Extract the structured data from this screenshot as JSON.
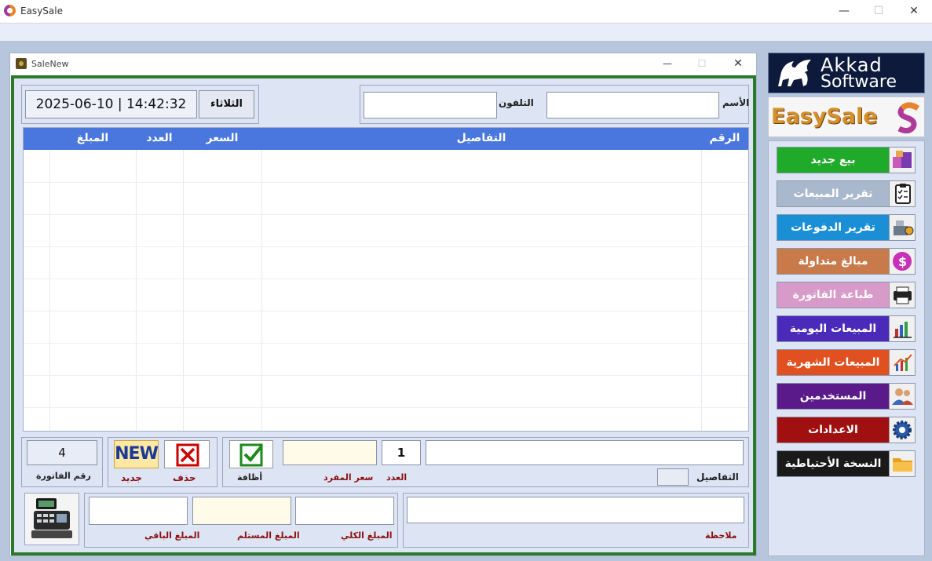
{
  "app": {
    "title": "EasySale",
    "min": "—",
    "max": "☐",
    "close": "✕"
  },
  "child": {
    "title": "SaleNew",
    "min": "—",
    "max": "☐",
    "close": "✕"
  },
  "header": {
    "name_label": "الأسم",
    "name_value": "",
    "phone_label": "التلفون",
    "phone_value": "",
    "datetime": "2025-06-10 | 14:42:32",
    "day": "الثلاثاء"
  },
  "grid": {
    "columns": [
      "الرقم",
      "التفاصيل",
      "السعر",
      "العدد",
      "المبلغ"
    ],
    "rows": []
  },
  "entry": {
    "details_label": "التفاصيل",
    "details_value": "",
    "qty_label": "العدد",
    "qty_value": "1",
    "unit_price_label": "سعر المفرد",
    "unit_price_value": "",
    "add_label": "أظافة"
  },
  "actions": {
    "delete_label": "حذف",
    "new_label": "جديد",
    "new_icon_text": "NEW"
  },
  "invoice": {
    "number_label": "رقم الفاتورة",
    "number_value": "4"
  },
  "totals": {
    "note_label": "ملاحظة",
    "note_value": "",
    "total_label": "المبلغ الكلي",
    "total_value": "",
    "received_label": "المبلغ المستلم",
    "received_value": "",
    "remaining_label": "المبلغ الباقي",
    "remaining_value": ""
  },
  "brand": {
    "akkad_line1": "Akkad",
    "akkad_line2": "Software",
    "easysale": "EasySale"
  },
  "menu": [
    {
      "label": "بيع جديد",
      "icon": "boxes-icon",
      "color": "#1faa2a"
    },
    {
      "label": "تقرير المبيعات",
      "icon": "clipboard-icon",
      "color": "#a9b8cc"
    },
    {
      "label": "تقرير الدفوعات",
      "icon": "cash-register-icon",
      "color": "#1a8fd6"
    },
    {
      "label": "مبالغ متداولة",
      "icon": "coin-icon",
      "color": "#c87a4a"
    },
    {
      "label": "طباعة الفاتورة",
      "icon": "printer-icon",
      "color": "#d89ac8"
    },
    {
      "label": "المبيعات اليومية",
      "icon": "bar-chart-icon",
      "color": "#4a2ab8"
    },
    {
      "label": "المبيعات الشهرية",
      "icon": "line-chart-icon",
      "color": "#e05020"
    },
    {
      "label": "المستخدمين",
      "icon": "users-icon",
      "color": "#5a1a8a"
    },
    {
      "label": "الاعدادات",
      "icon": "gear-icon",
      "color": "#a01010"
    },
    {
      "label": "النسخة الأحتياطية",
      "icon": "folder-icon",
      "color": "#1a1a1a"
    }
  ]
}
